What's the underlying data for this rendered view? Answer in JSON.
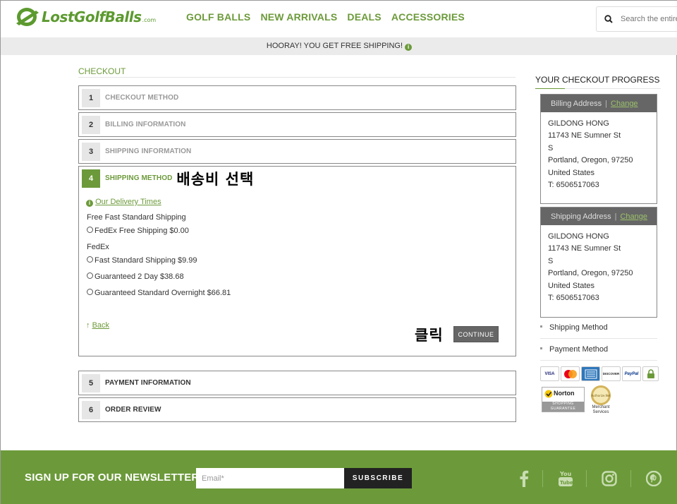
{
  "header": {
    "logo_text": "LostGolfBalls",
    "logo_suffix": ".com",
    "nav": [
      "GOLF BALLS",
      "NEW ARRIVALS",
      "DEALS",
      "ACCESSORIES"
    ],
    "search_placeholder": "Search the entire store..."
  },
  "shipping_banner": "HOORAY! YOU GET FREE SHIPPING!",
  "checkout": {
    "title": "CHECKOUT",
    "steps": [
      {
        "num": "1",
        "label": "CHECKOUT METHOD"
      },
      {
        "num": "2",
        "label": "BILLING INFORMATION"
      },
      {
        "num": "3",
        "label": "SHIPPING INFORMATION"
      },
      {
        "num": "4",
        "label": "SHIPPING METHOD"
      },
      {
        "num": "5",
        "label": "PAYMENT INFORMATION"
      },
      {
        "num": "6",
        "label": "ORDER REVIEW"
      }
    ],
    "annotation_select": "배송비 선택",
    "annotation_click": "클릭",
    "delivery_link": "Our Delivery Times",
    "group_free": "Free Fast Standard Shipping",
    "option_free": "FedEx Free Shipping $0.00",
    "group_fedex": "FedEx",
    "options_fedex": [
      "Fast Standard Shipping $9.99",
      "Guaranteed 2 Day $38.68",
      "Guaranteed Standard Overnight $66.81"
    ],
    "back_label": "Back",
    "continue_label": "CONTINUE"
  },
  "sidebar": {
    "title": "YOUR CHECKOUT PROGRESS",
    "billing": {
      "heading": "Billing Address",
      "change": "Change",
      "lines": [
        "GILDONG HONG",
        "11743 NE Sumner St",
        "S",
        "Portland, Oregon, 97250",
        "United States",
        "T: 6506517063"
      ]
    },
    "shipping": {
      "heading": "Shipping Address",
      "change": "Change",
      "lines": [
        "GILDONG HONG",
        "11743 NE Sumner St",
        "S",
        "Portland, Oregon, 97250",
        "United States",
        "T: 6506517063"
      ]
    },
    "items": [
      "Shipping Method",
      "Payment Method"
    ],
    "cards": [
      "VISA",
      "MC",
      "AMEX",
      "DISCOVER",
      "PayPal",
      "lock"
    ],
    "norton_top": "Norton",
    "norton_bottom": "SHOPPING GUARANTEE",
    "seal_text": "Authorize.Net",
    "authnet_text_1": "Merchant",
    "authnet_text_2": "Services"
  },
  "footer": {
    "newsletter_title": "SIGN UP FOR OUR NEWSLETTER",
    "email_placeholder": "Email*",
    "subscribe_label": "SUBSCRIBE",
    "social": [
      "facebook-icon",
      "youtube-icon",
      "instagram-icon",
      "pinterest-icon"
    ]
  },
  "colors": {
    "brand_green": "#6c9a3a",
    "dark_button": "#666666",
    "footer_green": "#6c9a3a"
  }
}
